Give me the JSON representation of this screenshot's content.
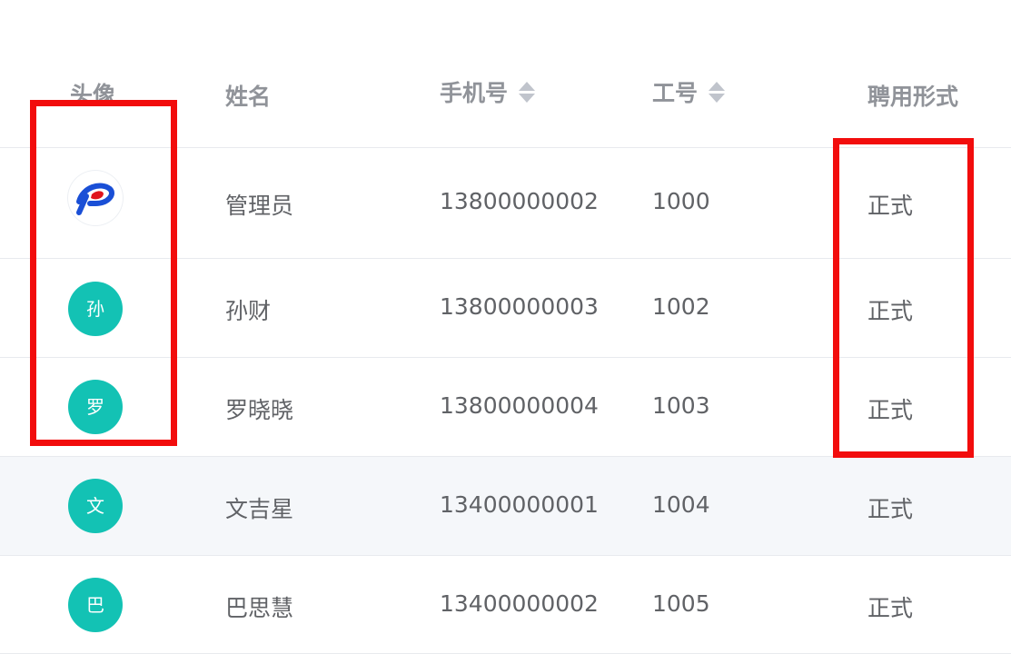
{
  "columns": {
    "avatar": "头像",
    "name": "姓名",
    "phone": "手机号",
    "employee_no": "工号",
    "form": "聘用形式"
  },
  "rows": [
    {
      "avatar_type": "image",
      "avatar_icon": "logo-icon",
      "avatar_text": "",
      "name": "管理员",
      "phone": "13800000002",
      "employee_no": "1000",
      "form": "正式"
    },
    {
      "avatar_type": "text",
      "avatar_text": "孙",
      "name": "孙财",
      "phone": "13800000003",
      "employee_no": "1002",
      "form": "正式"
    },
    {
      "avatar_type": "text",
      "avatar_text": "罗",
      "name": "罗晓晓",
      "phone": "13800000004",
      "employee_no": "1003",
      "form": "正式"
    },
    {
      "avatar_type": "text",
      "avatar_text": "文",
      "name": "文吉星",
      "phone": "13400000001",
      "employee_no": "1004",
      "form": "正式"
    },
    {
      "avatar_type": "text",
      "avatar_text": "巴",
      "name": "巴思慧",
      "phone": "13400000002",
      "employee_no": "1005",
      "form": "正式"
    }
  ],
  "colors": {
    "avatar_bg": "#13c2b4",
    "annotation": "#f20d0d",
    "hover_row": "#f5f7fa",
    "header_text": "#909399",
    "cell_text": "#606266"
  }
}
